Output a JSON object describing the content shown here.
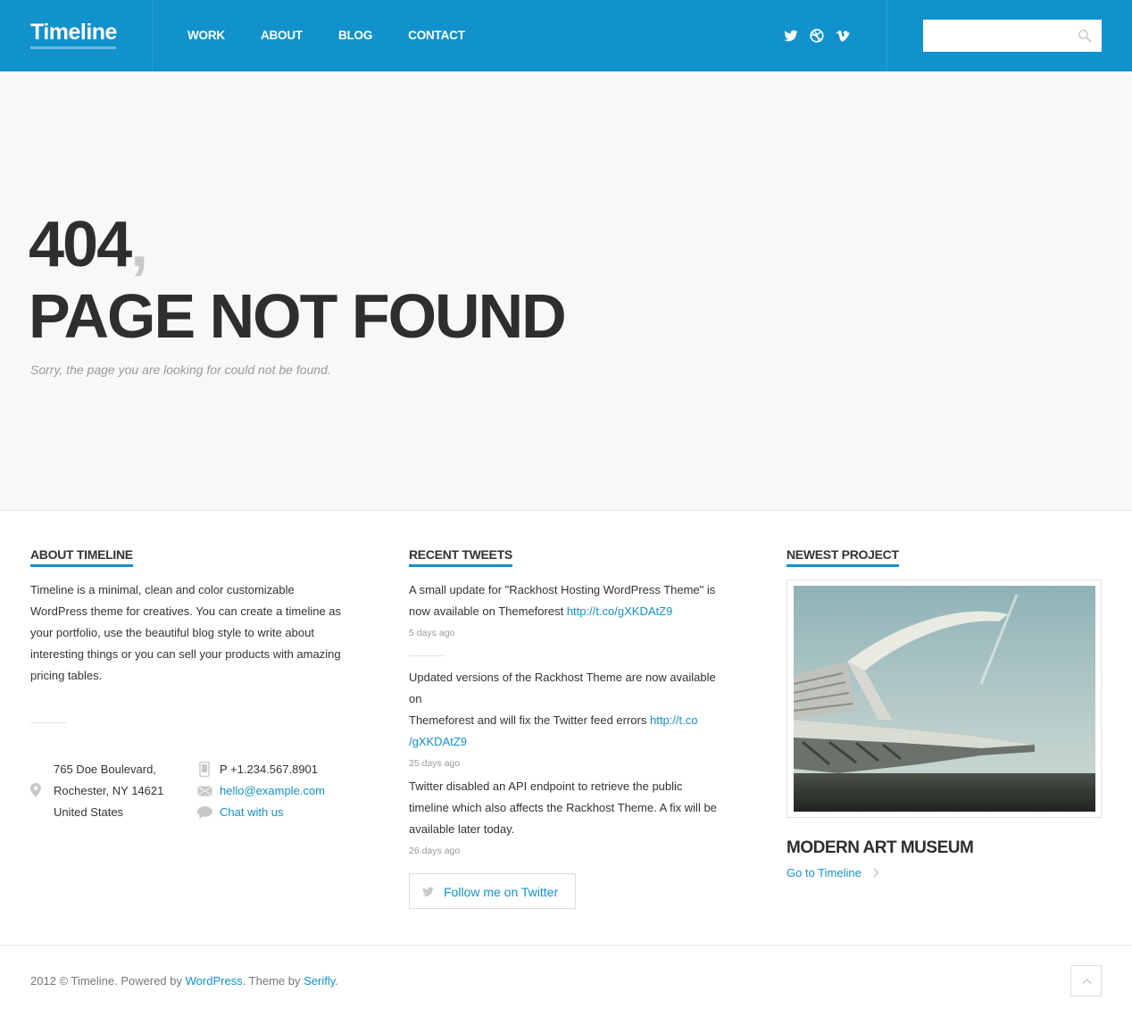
{
  "header": {
    "logo": "Timeline",
    "nav": [
      "WORK",
      "ABOUT",
      "BLOG",
      "CONTACT"
    ],
    "social_icons": [
      "twitter-icon",
      "dribbble-icon",
      "vimeo-icon"
    ],
    "search": {
      "placeholder": "",
      "icon": "search-icon"
    },
    "colors": {
      "accent": "#1192cc"
    }
  },
  "hero": {
    "code": "404",
    "comma": ",",
    "title": "PAGE NOT FOUND",
    "subtitle": "Sorry, the page you are looking for could not be found."
  },
  "about": {
    "title": "ABOUT TIMELINE",
    "text": "Timeline is a minimal, clean and color customizable WordPress theme for creatives. You can create a timeline as your portfolio, use the beautiful blog style to write about interesting things or you can sell your products with amazing pricing tables.",
    "address": [
      "765 Doe Boulevard,",
      "Rochester, NY 14621",
      "United States"
    ],
    "phone": "P +1.234.567.8901",
    "email": "hello@example.com",
    "chat": "Chat with us"
  },
  "tweets": {
    "title": "RECENT TWEETS",
    "items": [
      {
        "lines": [
          "A small update for \"Rackhost Hosting WordPress Theme\" is",
          "now available on Themeforest "
        ],
        "link": "http://t.co/gXKDAtZ9",
        "time": "5 days ago"
      },
      {
        "lines": [
          "Updated versions of the Rackhost Theme are now available on",
          "Themeforest and will fix the Twitter feed errors "
        ],
        "link1": "http://t.co",
        "link2": "/gXKDAtZ9",
        "time": "25 days ago"
      },
      {
        "lines": [
          "Twitter disabled an API endpoint to retrieve the public",
          "timeline which also affects the Rackhost Theme. A fix will be",
          "available later today."
        ],
        "time": "26 days ago"
      }
    ],
    "follow_label": "Follow me on Twitter"
  },
  "project": {
    "title": "NEWEST PROJECT",
    "name": "MODERN ART MUSEUM",
    "link": "Go to Timeline"
  },
  "footer": {
    "copyright": "2012 © Timeline. Powered by ",
    "wordpress": "WordPress",
    "theme_by": ". Theme by ",
    "author": "Serifly",
    "period": "."
  }
}
